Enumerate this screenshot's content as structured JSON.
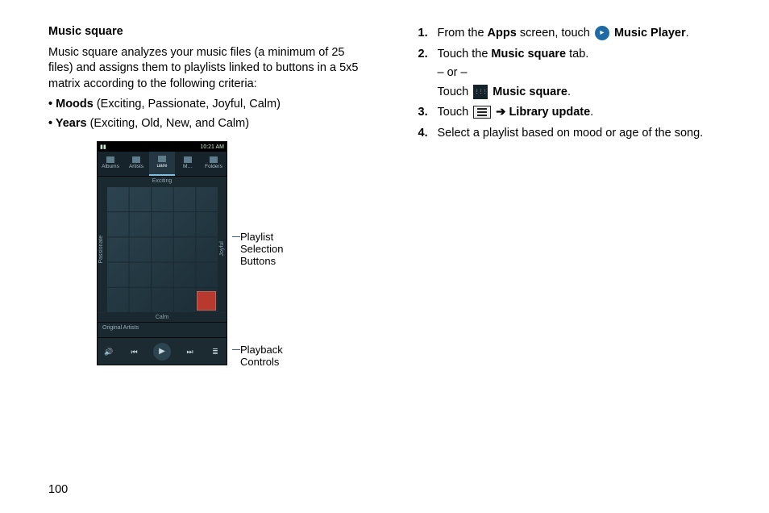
{
  "left": {
    "heading": "Music square",
    "intro": "Music square analyzes your music files (a minimum of 25 files) and assigns them to playlists linked to buttons in a 5x5 matrix according to the following criteria:",
    "bullets": [
      {
        "label": "Moods",
        "rest": " (Exciting, Passionate, Joyful, Calm)"
      },
      {
        "label": "Years",
        "rest": " (Exciting, Old, New, and Calm)"
      }
    ]
  },
  "phone": {
    "time": "10:21 AM",
    "status_left": "▮▮",
    "tabs": {
      "t0": "Albums",
      "t1": "Artists",
      "t2": "uare",
      "t3": "M…",
      "t4": "Folders"
    },
    "top_label": "Exciting",
    "left_label": "Passionate",
    "right_label": "Joyful",
    "bottom_label": "Calm",
    "nowplaying": "Original Artists",
    "controls": {
      "vol": "🔊",
      "prev": "⏮",
      "play": "▶",
      "next": "⏭",
      "list": "≣"
    }
  },
  "callouts": {
    "c1a": "Playlist",
    "c1b": "Selection",
    "c1c": "Buttons",
    "c2a": "Playback",
    "c2b": "Controls"
  },
  "steps": {
    "s1_a": "From the ",
    "s1_b": "Apps",
    "s1_c": " screen, touch ",
    "s1_d": "Music Player",
    "s1_e": ".",
    "s2_a": "Touch the ",
    "s2_b": "Music square",
    "s2_c": " tab.",
    "s2_or": "– or –",
    "s2_touch": "Touch ",
    "s2_ms": "Music square",
    "s2_dot": ".",
    "s3_a": "Touch ",
    "s3_arrow": " ➔ ",
    "s3_b": "Library update",
    "s3_c": ".",
    "s4": "Select a playlist based on mood or age of the song."
  },
  "page_number": "100"
}
